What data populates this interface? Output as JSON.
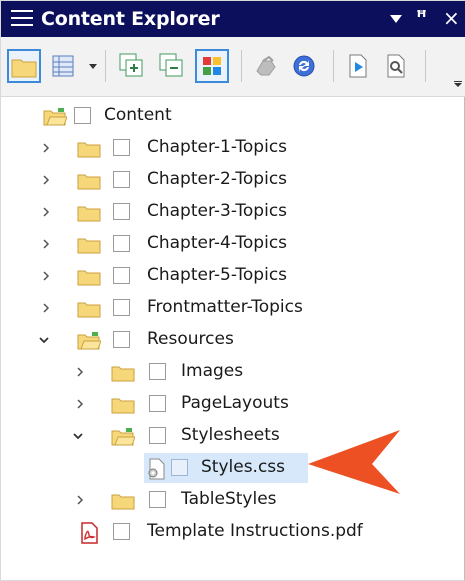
{
  "window": {
    "title": "Content Explorer"
  },
  "toolbar": {
    "buttons": [
      "folder-icon",
      "grid-view-icon",
      "dropdown-arrow-icon",
      "expand-all-icon",
      "collapse-all-icon",
      "color-tiles-icon",
      "bind-icon",
      "sync-icon",
      "file-export-icon",
      "file-search-icon"
    ]
  },
  "tree": {
    "root": {
      "label": "Content"
    },
    "items": [
      {
        "label": "Chapter-1-Topics",
        "expanded": false
      },
      {
        "label": "Chapter-2-Topics",
        "expanded": false
      },
      {
        "label": "Chapter-3-Topics",
        "expanded": false
      },
      {
        "label": "Chapter-4-Topics",
        "expanded": false
      },
      {
        "label": "Chapter-5-Topics",
        "expanded": false
      },
      {
        "label": "Frontmatter-Topics",
        "expanded": false
      },
      {
        "label": "Resources",
        "expanded": true
      },
      {
        "label": "Images",
        "expanded": false
      },
      {
        "label": "PageLayouts",
        "expanded": false
      },
      {
        "label": "Stylesheets",
        "expanded": true
      },
      {
        "label": "Styles.css",
        "selected": true
      },
      {
        "label": "TableStyles",
        "expanded": false
      },
      {
        "label": "Template Instructions.pdf"
      }
    ]
  },
  "colors": {
    "titlebar": "#0b0f5c",
    "selection": "#d6e8fa",
    "callout_arrow": "#ec5023",
    "folder": "#f6d77a"
  }
}
